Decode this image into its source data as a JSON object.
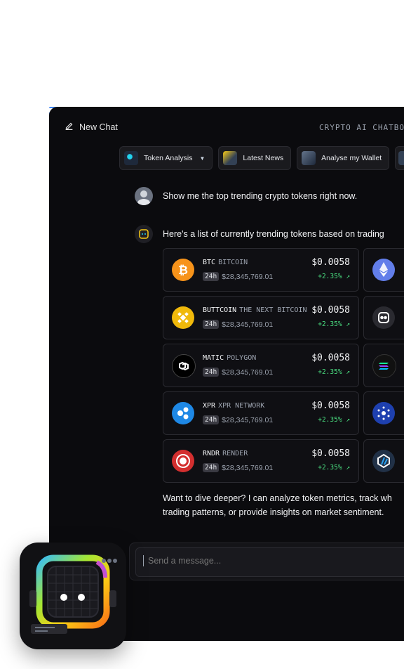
{
  "header": {
    "new_chat_label": "New Chat",
    "brand": "CRYPTO AI CHATBOT"
  },
  "chips": [
    {
      "label": "Token Analysis",
      "has_dropdown": true,
      "color": "#22d3ee"
    },
    {
      "label": "Latest News",
      "has_dropdown": false,
      "color": "#facc15"
    },
    {
      "label": "Analyse my Wallet",
      "has_dropdown": false,
      "color": "#94a3b8"
    }
  ],
  "messages": {
    "user": "Show me the top trending crypto tokens right now.",
    "bot_intro": "Here's a list of currently trending tokens based on trading",
    "bot_followup_line1": "Want to dive deeper? I can analyze token metrics, track wh",
    "bot_followup_line2": "trading patterns, or provide insights on market sentiment."
  },
  "tokens": [
    {
      "symbol": "BTC",
      "name": "BITCOIN",
      "period": "24h",
      "volume": "$28,345,769.01",
      "price": "$0.0058",
      "change": "+2.35% ↗",
      "color": "#f7931a",
      "icon": "bitcoin-icon"
    },
    {
      "symbol": "BUTTCOIN",
      "name": "THE NEXT BITCOIN",
      "period": "24h",
      "volume": "$28,345,769.01",
      "price": "$0.0058",
      "change": "+2.35% ↗",
      "color": "#f0b90b",
      "icon": "bnb-icon"
    },
    {
      "symbol": "MATIC",
      "name": "POLYGON",
      "period": "24h",
      "volume": "$28,345,769.01",
      "price": "$0.0058",
      "change": "+2.35% ↗",
      "color": "#ffffff",
      "icon": "polygon-icon"
    },
    {
      "symbol": "XPR",
      "name": "XPR NETWORK",
      "period": "24h",
      "volume": "$28,345,769.01",
      "price": "$0.0058",
      "change": "+2.35% ↗",
      "color": "#1e88e5",
      "icon": "xpr-icon"
    },
    {
      "symbol": "RNDR",
      "name": "RENDER",
      "period": "24h",
      "volume": "$28,345,769.01",
      "price": "$0.0058",
      "change": "+2.35% ↗",
      "color": "#d32f2f",
      "icon": "render-icon"
    }
  ],
  "tokens_right": [
    {
      "icon": "ethereum-icon",
      "color": "#627eea"
    },
    {
      "icon": "bot-coin-icon",
      "color": "#2a2a30"
    },
    {
      "icon": "solana-icon",
      "color": "#111111"
    },
    {
      "icon": "cardano-icon",
      "color": "#1e40af"
    },
    {
      "icon": "arbitrum-icon",
      "color": "#213147"
    }
  ],
  "input": {
    "placeholder": "Send a message..."
  },
  "colors": {
    "accent_green": "#4ade80",
    "background": "#0b0b0e"
  }
}
